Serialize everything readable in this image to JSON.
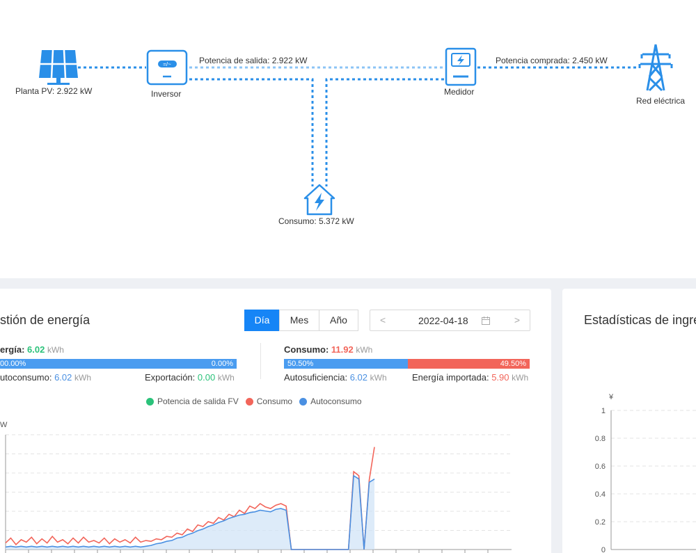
{
  "flow": {
    "pv_label": "Planta PV: 2.922 kW",
    "inverter_label": "Inversor",
    "output_power_label": "Potencia de salida: 2.922 kW",
    "meter_label": "Medidor",
    "purchased_power_label": "Potencia comprada: 2.450 kW",
    "grid_label": "Red eléctrica",
    "consumption_label": "Consumo: 5.372 kW",
    "accent_color": "#2a8fe8"
  },
  "energy": {
    "title": "stión de energía",
    "tabs": [
      {
        "label": "Día",
        "active": true
      },
      {
        "label": "Mes",
        "active": false
      },
      {
        "label": "Año",
        "active": false
      }
    ],
    "date": "2022-04-18",
    "date_prev": "<",
    "date_next": ">",
    "production": {
      "label": "ergía:",
      "value": "6.02",
      "unit": "kWh",
      "bar_left": "00.00%",
      "bar_right": "0.00%",
      "self_use_label": "utoconsumo:",
      "self_use_value": "6.02",
      "self_use_unit": "kWh",
      "export_label": "Exportación:",
      "export_value": "0.00",
      "export_unit": "kWh"
    },
    "consumption": {
      "label": "Consumo:",
      "value": "11.92",
      "unit": "kWh",
      "bar_left": "50.50%",
      "bar_right": "49.50%",
      "bar_left_fraction": 0.505,
      "self_sufficiency_label": "Autosuficiencia:",
      "self_sufficiency_value": "6.02",
      "self_sufficiency_unit": "kWh",
      "import_label": "Energía importada:",
      "import_value": "5.90",
      "import_unit": "kWh"
    },
    "legend": [
      {
        "label": "Potencia de salida FV",
        "color": "#2bc27a"
      },
      {
        "label": "Consumo",
        "color": "#f2655a"
      },
      {
        "label": "Autoconsumo",
        "color": "#4a90e2"
      }
    ],
    "y_unit": "W"
  },
  "income": {
    "title": "Estadísticas de ingre",
    "y_unit": "¥"
  },
  "chart_data": [
    {
      "type": "line",
      "ylabel": "W",
      "series": [
        {
          "name": "Consumo",
          "color": "#f2655a",
          "values": [
            0.8,
            1.4,
            0.6,
            1.2,
            0.9,
            1.5,
            0.7,
            1.3,
            0.8,
            1.6,
            0.9,
            1.2,
            0.7,
            1.4,
            0.8,
            1.5,
            0.9,
            1.1,
            0.8,
            1.4,
            0.7,
            1.3,
            0.9,
            1.2,
            0.8,
            1.5,
            0.9,
            1.1,
            1.0,
            1.3,
            1.2,
            1.6,
            1.5,
            2.0,
            1.8,
            2.5,
            2.2,
            3.0,
            2.8,
            3.4,
            3.2,
            3.9,
            3.6,
            4.3,
            4.0,
            4.8,
            4.4,
            5.3,
            5.0,
            5.6,
            5.2,
            5.0,
            5.4,
            5.6,
            5.3,
            0,
            0,
            0,
            0,
            0,
            0,
            0,
            0,
            0,
            0,
            0,
            0,
            9.5,
            9.0,
            0,
            8.5,
            12.5
          ]
        },
        {
          "name": "Autoconsumo",
          "color": "#4a90e2",
          "values": [
            0.3,
            0.4,
            0.3,
            0.4,
            0.3,
            0.4,
            0.3,
            0.4,
            0.3,
            0.4,
            0.3,
            0.4,
            0.3,
            0.4,
            0.3,
            0.4,
            0.3,
            0.4,
            0.3,
            0.4,
            0.3,
            0.4,
            0.3,
            0.4,
            0.3,
            0.4,
            0.3,
            0.4,
            0.5,
            0.7,
            0.8,
            1.0,
            1.1,
            1.4,
            1.5,
            1.8,
            2.0,
            2.3,
            2.5,
            2.8,
            3.0,
            3.3,
            3.5,
            3.8,
            4.0,
            4.2,
            4.3,
            4.5,
            4.6,
            4.8,
            4.7,
            4.6,
            4.9,
            5.0,
            4.8,
            0,
            0,
            0,
            0,
            0,
            0,
            0,
            0,
            0,
            0,
            0,
            0,
            9.0,
            8.6,
            0,
            8.2,
            8.6
          ]
        }
      ]
    },
    {
      "type": "bar",
      "ylabel": "¥",
      "ylim": [
        0,
        1
      ],
      "y_ticks": [
        "0",
        "0.2",
        "0.4",
        "0.6",
        "0.8",
        "1"
      ]
    }
  ]
}
